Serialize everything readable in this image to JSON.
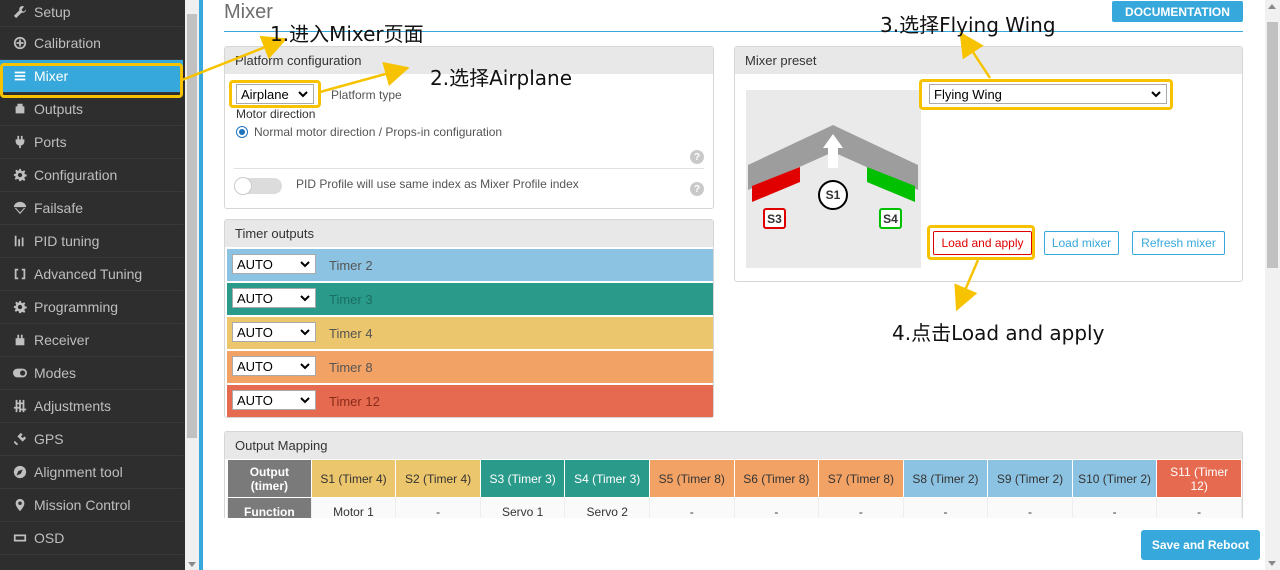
{
  "sidebar": {
    "items": [
      {
        "label": "Setup",
        "icon": "wrench-icon"
      },
      {
        "label": "Calibration",
        "icon": "crosshair-icon"
      },
      {
        "label": "Mixer",
        "icon": "mixer-icon"
      },
      {
        "label": "Outputs",
        "icon": "motor-icon"
      },
      {
        "label": "Ports",
        "icon": "plug-icon"
      },
      {
        "label": "Configuration",
        "icon": "gear-icon"
      },
      {
        "label": "Failsafe",
        "icon": "parachute-icon"
      },
      {
        "label": "PID tuning",
        "icon": "pid-icon"
      },
      {
        "label": "Advanced Tuning",
        "icon": "tuning-icon"
      },
      {
        "label": "Programming",
        "icon": "gear-icon"
      },
      {
        "label": "Receiver",
        "icon": "receiver-icon"
      },
      {
        "label": "Modes",
        "icon": "toggle-icon"
      },
      {
        "label": "Adjustments",
        "icon": "sliders-icon"
      },
      {
        "label": "GPS",
        "icon": "satellite-icon"
      },
      {
        "label": "Alignment tool",
        "icon": "compass-icon"
      },
      {
        "label": "Mission Control",
        "icon": "map-pin-icon"
      },
      {
        "label": "OSD",
        "icon": "osd-icon"
      }
    ],
    "active": "Mixer"
  },
  "header": {
    "title": "Mixer",
    "documentation": "DOCUMENTATION"
  },
  "platform": {
    "heading": "Platform configuration",
    "type_value": "Airplane",
    "type_label": "Platform type",
    "motor_direction_label": "Motor direction",
    "motor_direction_option": "Normal motor direction / Props-in configuration",
    "pid_profile_label": "PID Profile will use same index as Mixer Profile index",
    "help_glyph": "?"
  },
  "timers": {
    "heading": "Timer outputs",
    "rows": [
      {
        "value": "AUTO",
        "label": "Timer 2",
        "color": "#8dc3e2"
      },
      {
        "value": "AUTO",
        "label": "Timer 3",
        "color": "#2a9b8a"
      },
      {
        "value": "AUTO",
        "label": "Timer 4",
        "color": "#ecc66c"
      },
      {
        "value": "AUTO",
        "label": "Timer 8",
        "color": "#f3a265"
      },
      {
        "value": "AUTO",
        "label": "Timer 12",
        "color": "#e56a4f"
      }
    ]
  },
  "preset": {
    "heading": "Mixer preset",
    "selected": "Flying Wing",
    "servo_left": "S3",
    "servo_right": "S4",
    "motor": "S1",
    "load_apply": "Load and apply",
    "load_mixer": "Load mixer",
    "refresh_mixer": "Refresh mixer"
  },
  "output_mapping": {
    "heading": "Output Mapping",
    "row_output": "Output (timer)",
    "row_function": "Function",
    "columns": [
      {
        "output": "S1 (Timer 4)",
        "function": "Motor 1",
        "color": "#ecc66c"
      },
      {
        "output": "S2 (Timer 4)",
        "function": "-",
        "color": "#ecc66c"
      },
      {
        "output": "S3 (Timer 3)",
        "function": "Servo 1",
        "color": "#2a9b8a"
      },
      {
        "output": "S4 (Timer 3)",
        "function": "Servo 2",
        "color": "#2a9b8a"
      },
      {
        "output": "S5 (Timer 8)",
        "function": "-",
        "color": "#f3a265"
      },
      {
        "output": "S6 (Timer 8)",
        "function": "-",
        "color": "#f3a265"
      },
      {
        "output": "S7 (Timer 8)",
        "function": "-",
        "color": "#f3a265"
      },
      {
        "output": "S8 (Timer 2)",
        "function": "-",
        "color": "#8dc3e2"
      },
      {
        "output": "S9 (Timer 2)",
        "function": "-",
        "color": "#8dc3e2"
      },
      {
        "output": "S10 (Timer 2)",
        "function": "-",
        "color": "#8dc3e2"
      },
      {
        "output": "S11 (Timer 12)",
        "function": "-",
        "color": "#e56a4f"
      }
    ]
  },
  "footer": {
    "save_reboot": "Save and Reboot"
  },
  "annotations": {
    "step1": "1.进入Mixer页面",
    "step2": "2.选择Airplane",
    "step3": "3.选择Flying Wing",
    "step4": "4.点击Load and apply",
    "highlight_color": "#f7c300"
  }
}
